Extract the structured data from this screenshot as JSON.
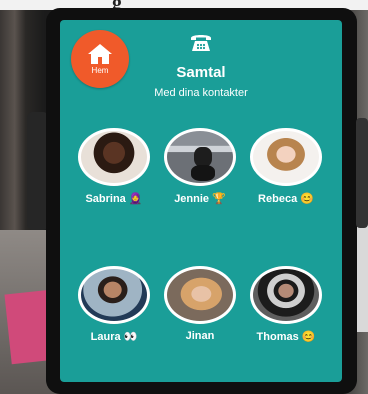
{
  "photo_top_text": "g",
  "home": {
    "label": "Hem"
  },
  "header": {
    "title": "Samtal",
    "subtitle": "Med dina kontakter"
  },
  "contacts": [
    {
      "name": "Sabrina 🧕"
    },
    {
      "name": "Jennie 🏆"
    },
    {
      "name": "Rebeca 😊"
    },
    {
      "name": "Laura 👀"
    },
    {
      "name": "Jinan"
    },
    {
      "name": "Thomas 😊"
    }
  ],
  "colors": {
    "screen": "#1a9e98",
    "home_button": "#f05a2a",
    "text": "#ffffff"
  },
  "icons": {
    "home": "house-icon",
    "call": "telephone-icon"
  }
}
